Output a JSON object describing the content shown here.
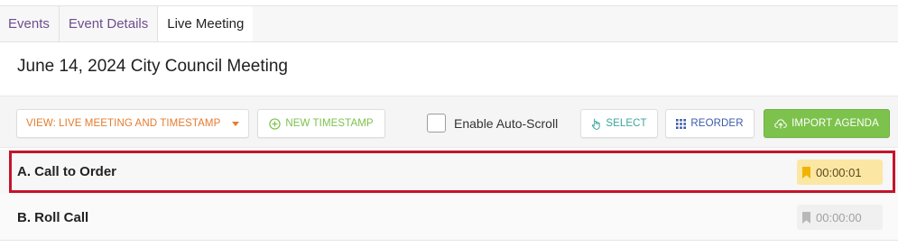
{
  "breadcrumbs": [
    {
      "label": "Events"
    },
    {
      "label": "Event Details"
    },
    {
      "label": "Live Meeting"
    }
  ],
  "page": {
    "title": "June 14, 2024 City Council Meeting"
  },
  "toolbar": {
    "view_label": "VIEW: LIVE MEETING AND TIMESTAMP",
    "new_timestamp_label": "NEW TIMESTAMP",
    "auto_scroll_label": "Enable Auto-Scroll",
    "auto_scroll_checked": false,
    "select_label": "SELECT",
    "reorder_label": "REORDER",
    "import_agenda_label": "IMPORT AGENDA"
  },
  "agenda": [
    {
      "label": "A. Call to Order",
      "timestamp": "00:00:01",
      "selected": true
    },
    {
      "label": "B. Roll Call",
      "timestamp": "00:00:00",
      "selected": false
    }
  ],
  "colors": {
    "link_purple": "#6f4e8f",
    "view_orange": "#e47b2e",
    "new_green": "#7cc24c",
    "select_teal": "#3aa6a0",
    "reorder_blue": "#3a5aa8",
    "import_green": "#7cc24c",
    "selected_border": "#c4142c",
    "timestamp_active_bg": "#fbe6a4",
    "bookmark_active": "#f0b400"
  },
  "icons": {
    "view_caret": "caret-down-icon",
    "new_timestamp": "plus-circle-icon",
    "select": "pointer-hand-icon",
    "reorder": "grid-dots-icon",
    "import_agenda": "cloud-upload-icon",
    "timestamp": "bookmark-icon"
  }
}
